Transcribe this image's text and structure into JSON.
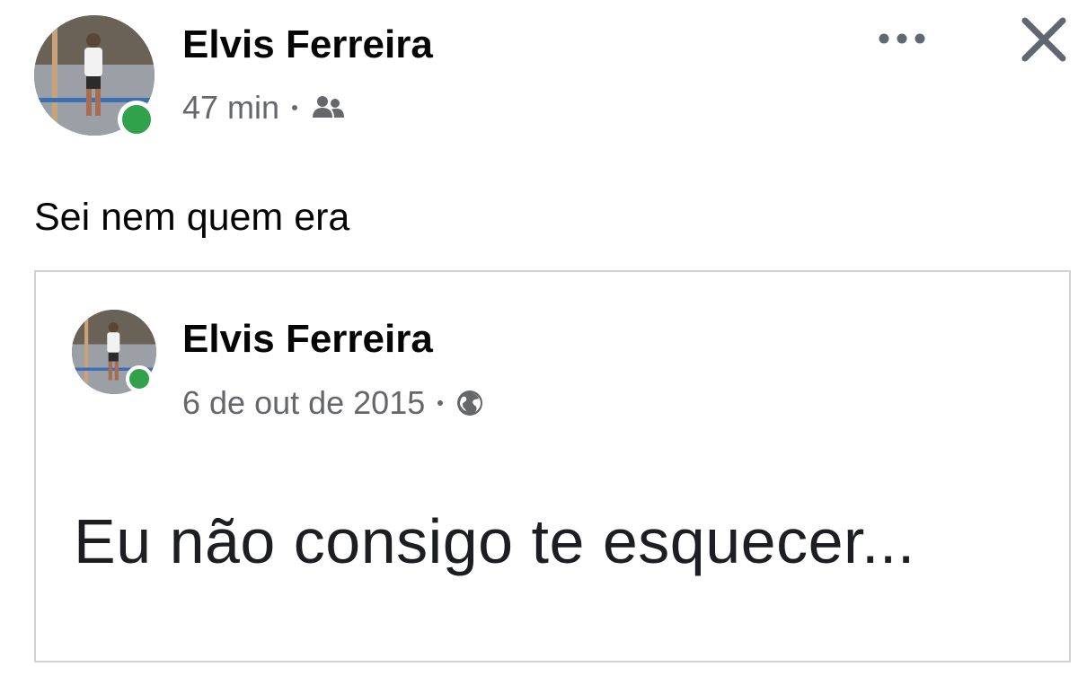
{
  "post": {
    "author": "Elvis Ferreira",
    "time": "47 min",
    "audience_icon": "friends-icon",
    "text": "Sei nem quem era",
    "more_icon": "more-options-icon",
    "close_icon": "close-icon",
    "online_status_color": "#31a24c"
  },
  "shared_post": {
    "author": "Elvis Ferreira",
    "date": "6 de out de 2015",
    "audience_icon": "globe-icon",
    "text": "Eu não consigo te esquecer..."
  },
  "colors": {
    "name": "#050505",
    "meta": "#65676b",
    "card_border": "#cfd2d6"
  }
}
